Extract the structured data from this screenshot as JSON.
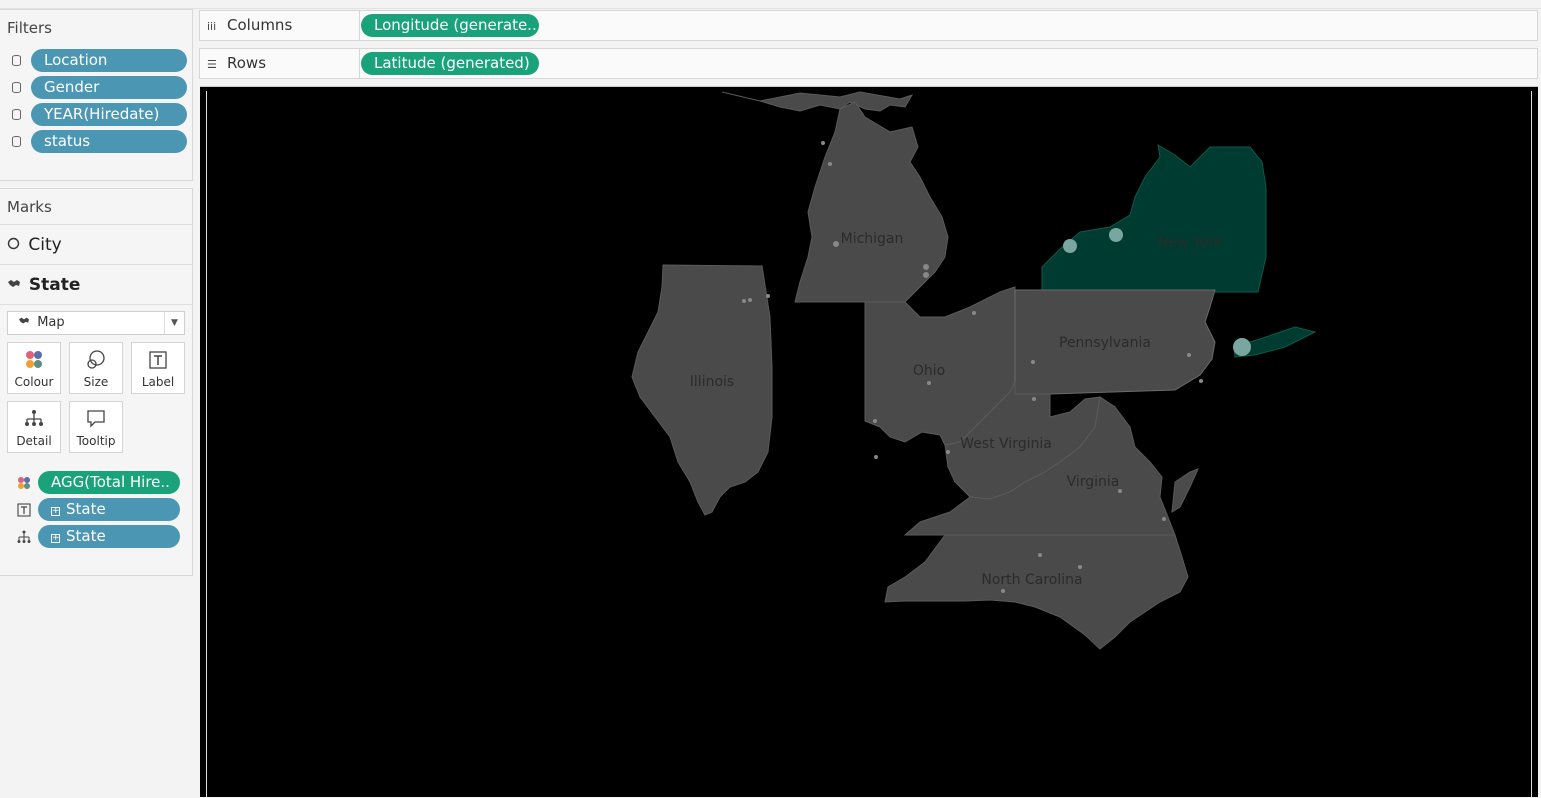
{
  "filters": {
    "title": "Filters",
    "items": [
      {
        "label": "Location"
      },
      {
        "label": "Gender"
      },
      {
        "label": "YEAR(Hiredate)"
      },
      {
        "label": "status"
      }
    ]
  },
  "marks": {
    "title": "Marks",
    "layers": [
      {
        "label": "City",
        "icon": "circle-icon"
      },
      {
        "label": "State",
        "icon": "map-icon"
      }
    ],
    "mark_type": "Map",
    "buttons": [
      {
        "label": "Colour",
        "icon": "colour-icon"
      },
      {
        "label": "Size",
        "icon": "size-icon"
      },
      {
        "label": "Label",
        "icon": "label-icon"
      },
      {
        "label": "Detail",
        "icon": "detail-icon"
      },
      {
        "label": "Tooltip",
        "icon": "tooltip-icon"
      }
    ],
    "encodings": [
      {
        "label": "AGG(Total Hire..",
        "type": "colour",
        "color": "green"
      },
      {
        "label": "State",
        "type": "label",
        "color": "blue"
      },
      {
        "label": "State",
        "type": "detail",
        "color": "blue"
      }
    ]
  },
  "shelves": {
    "columns": {
      "label": "Columns",
      "pill": "Longitude (generate.."
    },
    "rows": {
      "label": "Rows",
      "pill": "Latitude (generated)"
    }
  },
  "map": {
    "background": "#000000",
    "state_fill": "#4a4a4a",
    "highlight_fill": "#003b31",
    "states": [
      {
        "name": "Michigan"
      },
      {
        "name": "New York"
      },
      {
        "name": "Illinois"
      },
      {
        "name": "Ohio"
      },
      {
        "name": "Pennsylvania"
      },
      {
        "name": "West Virginia"
      },
      {
        "name": "Virginia"
      },
      {
        "name": "North Carolina"
      }
    ]
  }
}
